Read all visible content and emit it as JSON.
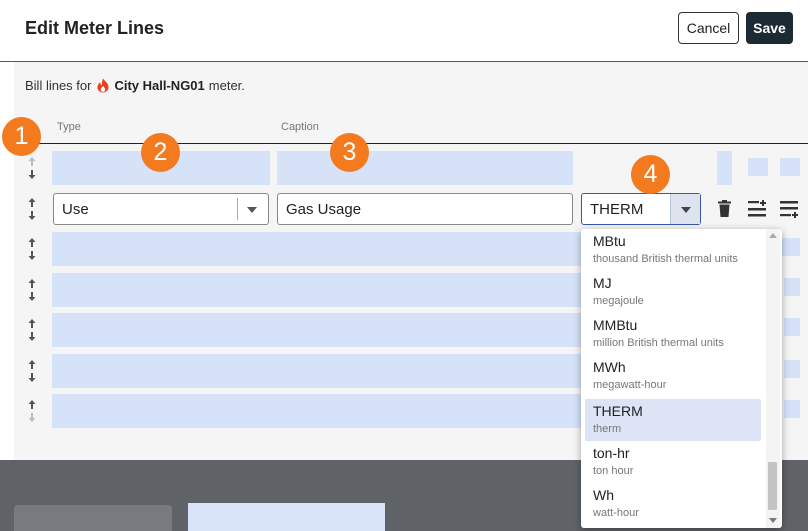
{
  "header": {
    "title": "Edit Meter Lines",
    "cancel_label": "Cancel",
    "save_label": "Save"
  },
  "bill_line": {
    "prefix": "Bill lines for",
    "meter_name": "City Hall-NG01",
    "suffix": "meter."
  },
  "columns": {
    "type": "Type",
    "caption": "Caption"
  },
  "row": {
    "type_value": "Use",
    "caption_value": "Gas Usage",
    "unit_value": "THERM"
  },
  "unit_options": [
    {
      "code": "MBtu",
      "description": "thousand British thermal units",
      "selected": false
    },
    {
      "code": "MJ",
      "description": "megajoule",
      "selected": false
    },
    {
      "code": "MMBtu",
      "description": "million British thermal units",
      "selected": false
    },
    {
      "code": "MWh",
      "description": "megawatt-hour",
      "selected": false
    },
    {
      "code": "THERM",
      "description": "therm",
      "selected": true
    },
    {
      "code": "ton-hr",
      "description": "ton hour",
      "selected": false
    },
    {
      "code": "Wh",
      "description": "watt-hour",
      "selected": false
    }
  ],
  "callouts": [
    "1",
    "2",
    "3",
    "4"
  ],
  "colors": {
    "accent": "#3a56a8",
    "callout": "#f47a20",
    "save_button": "#1c2a33",
    "placeholder": "#d6e2f8",
    "selected_option": "#dde4f6"
  },
  "icons": [
    "flame-icon",
    "reorder-arrows-icon",
    "trash-icon",
    "add-row-above-icon",
    "add-row-below-icon",
    "dropdown-caret-icon"
  ]
}
